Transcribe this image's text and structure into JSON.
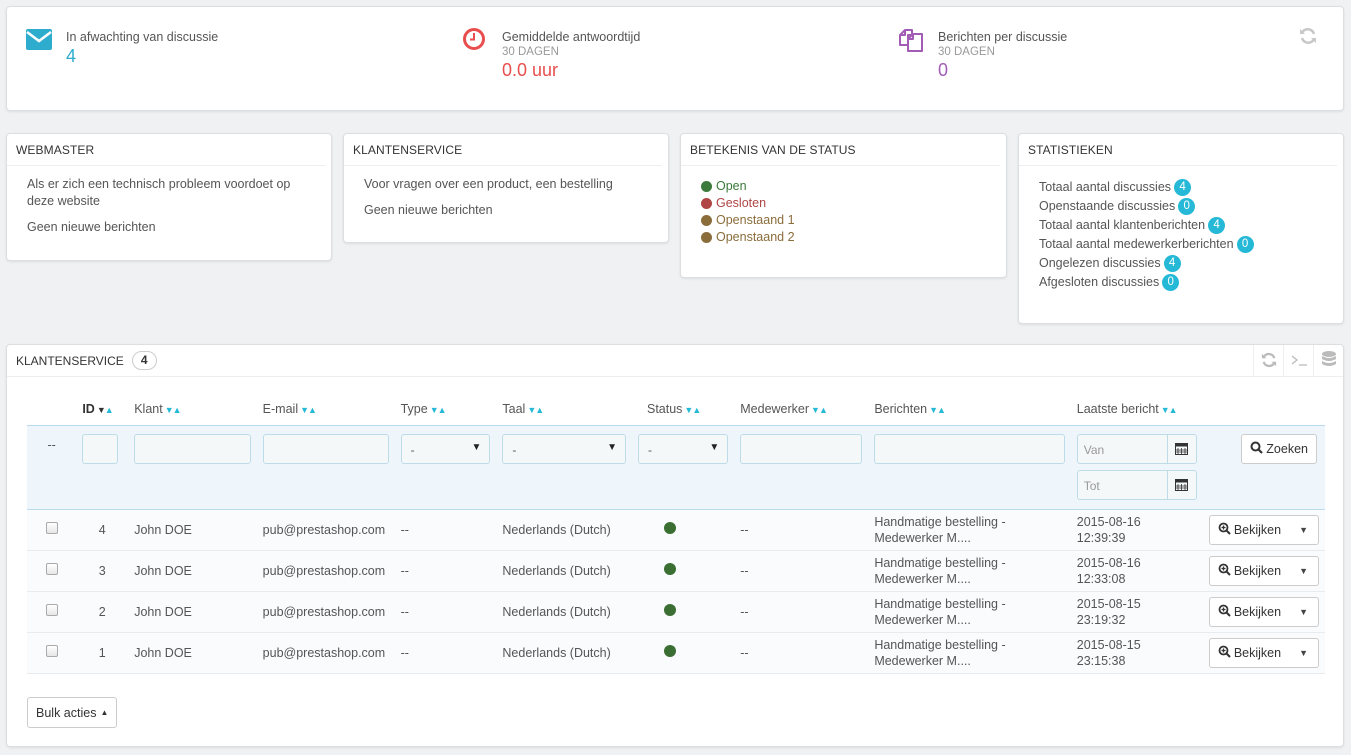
{
  "kpis": [
    {
      "icon": "envelope-icon",
      "title": "In afwachting van discussie",
      "subtitle": "",
      "value": "4",
      "color": "#2eacce"
    },
    {
      "icon": "clock-icon",
      "title": "Gemiddelde antwoordtijd",
      "subtitle": "30 DAGEN",
      "value": "0.0 uur",
      "color": "#e84e4e"
    },
    {
      "icon": "copy-icon",
      "title": "Berichten per discussie",
      "subtitle": "30 DAGEN",
      "value": "0",
      "color": "#a35cb5"
    }
  ],
  "webmaster": {
    "title": "WEBMASTER",
    "description": "Als er zich een technisch probleem voordoet op deze website",
    "status": "Geen nieuwe berichten"
  },
  "customer_service_box": {
    "title": "KLANTENSERVICE",
    "description": "Voor vragen over een product, een bestelling",
    "status": "Geen nieuwe berichten"
  },
  "status_legend": {
    "title": "BETEKENIS VAN DE STATUS",
    "items": [
      {
        "label": "Open",
        "color": "#3a7a3a",
        "text_color": "#3a7a3a"
      },
      {
        "label": "Gesloten",
        "color": "#b04545",
        "text_color": "#b04545"
      },
      {
        "label": "Openstaand 1",
        "color": "#8a6d3b",
        "text_color": "#8a6d3b"
      },
      {
        "label": "Openstaand 2",
        "color": "#8a6d3b",
        "text_color": "#8a6d3b"
      }
    ]
  },
  "statistics": {
    "title": "STATISTIEKEN",
    "items": [
      {
        "label": "Totaal aantal discussies",
        "value": "4"
      },
      {
        "label": "Openstaande discussies",
        "value": "0"
      },
      {
        "label": "Totaal aantal klantenberichten",
        "value": "4"
      },
      {
        "label": "Totaal aantal medewerkerberichten",
        "value": "0"
      },
      {
        "label": "Ongelezen discussies",
        "value": "4"
      },
      {
        "label": "Afgesloten discussies",
        "value": "0"
      }
    ]
  },
  "list": {
    "title": "KLANTENSERVICE",
    "count": "4",
    "columns": [
      "ID",
      "Klant",
      "E-mail",
      "Type",
      "Taal",
      "Status",
      "Medewerker",
      "Berichten",
      "Laatste bericht"
    ],
    "filters": {
      "dash": "--",
      "type_value": "-",
      "lang_value": "-",
      "status_value": "-",
      "date_from_placeholder": "Van",
      "date_to_placeholder": "Tot",
      "search_label": "Zoeken"
    },
    "rows": [
      {
        "id": "4",
        "customer": "John DOE",
        "email": "pub@prestashop.com",
        "type": "--",
        "language": "Nederlands (Dutch)",
        "status_color": "#3a6e32",
        "employee": "--",
        "message_line1": "Handmatige bestelling -",
        "message_line2": "Medewerker M....",
        "date": "2015-08-16",
        "time": "12:39:39",
        "action": "Bekijken"
      },
      {
        "id": "3",
        "customer": "John DOE",
        "email": "pub@prestashop.com",
        "type": "--",
        "language": "Nederlands (Dutch)",
        "status_color": "#3a6e32",
        "employee": "--",
        "message_line1": "Handmatige bestelling -",
        "message_line2": "Medewerker M....",
        "date": "2015-08-16",
        "time": "12:33:08",
        "action": "Bekijken"
      },
      {
        "id": "2",
        "customer": "John DOE",
        "email": "pub@prestashop.com",
        "type": "--",
        "language": "Nederlands (Dutch)",
        "status_color": "#3a6e32",
        "employee": "--",
        "message_line1": "Handmatige bestelling -",
        "message_line2": "Medewerker M....",
        "date": "2015-08-15",
        "time": "23:19:32",
        "action": "Bekijken"
      },
      {
        "id": "1",
        "customer": "John DOE",
        "email": "pub@prestashop.com",
        "type": "--",
        "language": "Nederlands (Dutch)",
        "status_color": "#3a6e32",
        "employee": "--",
        "message_line1": "Handmatige bestelling -",
        "message_line2": "Medewerker M....",
        "date": "2015-08-15",
        "time": "23:15:38",
        "action": "Bekijken"
      }
    ],
    "bulk_label": "Bulk acties"
  }
}
